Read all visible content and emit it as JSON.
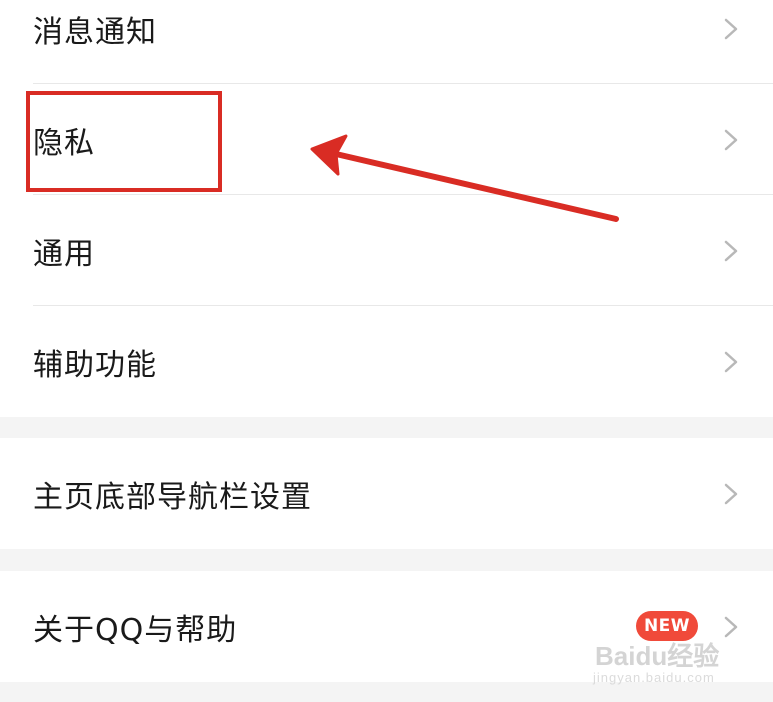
{
  "settings": {
    "items": [
      {
        "label": "消息通知"
      },
      {
        "label": "隐私"
      },
      {
        "label": "通用"
      },
      {
        "label": "辅助功能"
      },
      {
        "label": "主页底部导航栏设置"
      },
      {
        "label": "关于QQ与帮助",
        "badge": "NEW"
      }
    ]
  },
  "annotation": {
    "color": "#d92c24"
  },
  "watermark": {
    "text": "Baidu经验",
    "sub": "jingyan.baidu.com"
  },
  "colors": {
    "background": "#f4f4f4",
    "row": "#ffffff",
    "badge": "#f04a3a"
  },
  "icons": {
    "chevron": "chevron-right-icon"
  }
}
